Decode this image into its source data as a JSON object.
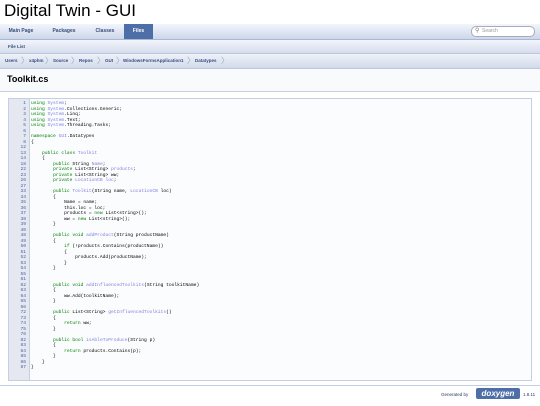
{
  "page": {
    "title": "Digital Twin - GUI"
  },
  "tabs": [
    {
      "label": "Main Page",
      "active": false
    },
    {
      "label": "Packages",
      "active": false
    },
    {
      "label": "Classes",
      "active": false
    },
    {
      "label": "Files",
      "active": true
    }
  ],
  "search": {
    "placeholder": "Search"
  },
  "subnav": {
    "label": "File List"
  },
  "breadcrumbs": [
    "Users",
    "x4phm",
    "Source",
    "Repos",
    "GUI",
    "WindowsFormsApplication1",
    "Datatypes"
  ],
  "file": {
    "title": "Toolkit.cs"
  },
  "code_lines": [
    {
      "n": "1",
      "segs": [
        {
          "t": "using ",
          "c": "kw"
        },
        {
          "t": "System",
          "c": "ty"
        },
        {
          "t": ";"
        }
      ]
    },
    {
      "n": "2",
      "segs": [
        {
          "t": "using ",
          "c": "kw"
        },
        {
          "t": "System",
          "c": "ty"
        },
        {
          "t": ".Collections.Generic;"
        }
      ]
    },
    {
      "n": "3",
      "segs": [
        {
          "t": "using ",
          "c": "kw"
        },
        {
          "t": "System",
          "c": "ty"
        },
        {
          "t": ".Linq;"
        }
      ]
    },
    {
      "n": "4",
      "segs": [
        {
          "t": "using ",
          "c": "kw"
        },
        {
          "t": "System",
          "c": "ty"
        },
        {
          "t": ".Text;"
        }
      ]
    },
    {
      "n": "5",
      "segs": [
        {
          "t": "using ",
          "c": "kw"
        },
        {
          "t": "System",
          "c": "ty"
        },
        {
          "t": ".Threading.Tasks;"
        }
      ]
    },
    {
      "n": "6",
      "segs": []
    },
    {
      "n": "7",
      "segs": [
        {
          "t": "namespace ",
          "c": "kw"
        },
        {
          "t": "GUI",
          "c": "ty"
        },
        {
          "t": ".Datatypes"
        }
      ]
    },
    {
      "n": "8",
      "segs": [
        {
          "t": "{"
        }
      ]
    },
    {
      "n": "12",
      "segs": []
    },
    {
      "n": "13",
      "segs": [
        {
          "t": "    "
        },
        {
          "t": "public class ",
          "c": "kw"
        },
        {
          "t": "Toolkit",
          "c": "ty"
        }
      ]
    },
    {
      "n": "14",
      "segs": [
        {
          "t": "    {"
        }
      ]
    },
    {
      "n": "18",
      "segs": [
        {
          "t": "        "
        },
        {
          "t": "public ",
          "c": "kw"
        },
        {
          "t": "String "
        },
        {
          "t": "Name",
          "c": "ty"
        },
        {
          "t": ";"
        }
      ]
    },
    {
      "n": "22",
      "segs": [
        {
          "t": "        "
        },
        {
          "t": "private ",
          "c": "kw"
        },
        {
          "t": "List<String> "
        },
        {
          "t": "products",
          "c": "ty"
        },
        {
          "t": ";"
        }
      ]
    },
    {
      "n": "23",
      "segs": [
        {
          "t": "        "
        },
        {
          "t": "private ",
          "c": "kw"
        },
        {
          "t": "List<String> ww;"
        }
      ]
    },
    {
      "n": "26",
      "segs": [
        {
          "t": "        "
        },
        {
          "t": "private ",
          "c": "kw"
        },
        {
          "t": "LocationCB loc",
          "c": "ty"
        },
        {
          "t": ";"
        }
      ]
    },
    {
      "n": "27",
      "segs": []
    },
    {
      "n": "33",
      "segs": [
        {
          "t": "        "
        },
        {
          "t": "public ",
          "c": "kw"
        },
        {
          "t": "Toolkit",
          "c": "ty"
        },
        {
          "t": "(String name, "
        },
        {
          "t": "LocationCB",
          "c": "ty"
        },
        {
          "t": " loc)"
        }
      ]
    },
    {
      "n": "34",
      "segs": [
        {
          "t": "        {"
        }
      ]
    },
    {
      "n": "35",
      "segs": [
        {
          "t": "            Name = name;"
        }
      ]
    },
    {
      "n": "36",
      "segs": [
        {
          "t": "            this.loc = loc;"
        }
      ]
    },
    {
      "n": "37",
      "segs": [
        {
          "t": "            products = "
        },
        {
          "t": "new ",
          "c": "kw"
        },
        {
          "t": "List<string>();"
        }
      ]
    },
    {
      "n": "38",
      "segs": [
        {
          "t": "            ww = "
        },
        {
          "t": "new ",
          "c": "kw"
        },
        {
          "t": "List<string>();"
        }
      ]
    },
    {
      "n": "39",
      "segs": [
        {
          "t": "        }"
        }
      ]
    },
    {
      "n": "40",
      "segs": []
    },
    {
      "n": "48",
      "segs": [
        {
          "t": "        "
        },
        {
          "t": "public void ",
          "c": "kw"
        },
        {
          "t": "addProduct",
          "c": "ty"
        },
        {
          "t": "(String productName)"
        }
      ]
    },
    {
      "n": "49",
      "segs": [
        {
          "t": "        {"
        }
      ]
    },
    {
      "n": "50",
      "segs": [
        {
          "t": "            "
        },
        {
          "t": "if ",
          "c": "kw"
        },
        {
          "t": "(!products.Contains(productName))"
        }
      ]
    },
    {
      "n": "51",
      "segs": [
        {
          "t": "            {"
        }
      ]
    },
    {
      "n": "52",
      "segs": [
        {
          "t": "                products.Add(productName);"
        }
      ]
    },
    {
      "n": "53",
      "segs": [
        {
          "t": "            }"
        }
      ]
    },
    {
      "n": "54",
      "segs": [
        {
          "t": "        }"
        }
      ]
    },
    {
      "n": "55",
      "segs": []
    },
    {
      "n": "61",
      "segs": []
    },
    {
      "n": "62",
      "segs": [
        {
          "t": "        "
        },
        {
          "t": "public void ",
          "c": "kw"
        },
        {
          "t": "addInfluencedToolkits",
          "c": "ty"
        },
        {
          "t": "(String toolkitName)"
        }
      ]
    },
    {
      "n": "63",
      "segs": [
        {
          "t": "        {"
        }
      ]
    },
    {
      "n": "64",
      "segs": [
        {
          "t": "            ww.Add(toolkitName);"
        }
      ]
    },
    {
      "n": "65",
      "segs": [
        {
          "t": "        }"
        }
      ]
    },
    {
      "n": "66",
      "segs": []
    },
    {
      "n": "72",
      "segs": [
        {
          "t": "        "
        },
        {
          "t": "public ",
          "c": "kw"
        },
        {
          "t": "List<String> "
        },
        {
          "t": "getInfluencedToolkits",
          "c": "ty"
        },
        {
          "t": "()"
        }
      ]
    },
    {
      "n": "73",
      "segs": [
        {
          "t": "        {"
        }
      ]
    },
    {
      "n": "74",
      "segs": [
        {
          "t": "            "
        },
        {
          "t": "return ",
          "c": "kw"
        },
        {
          "t": "ww;"
        }
      ]
    },
    {
      "n": "75",
      "segs": [
        {
          "t": "        }"
        }
      ]
    },
    {
      "n": "76",
      "segs": []
    },
    {
      "n": "82",
      "segs": [
        {
          "t": "        "
        },
        {
          "t": "public bool ",
          "c": "kw"
        },
        {
          "t": "isAbleToProduce",
          "c": "ty"
        },
        {
          "t": "(String p)"
        }
      ]
    },
    {
      "n": "83",
      "segs": [
        {
          "t": "        {"
        }
      ]
    },
    {
      "n": "84",
      "segs": [
        {
          "t": "            "
        },
        {
          "t": "return ",
          "c": "kw"
        },
        {
          "t": "products.Contains(p);"
        }
      ]
    },
    {
      "n": "85",
      "segs": [
        {
          "t": "        }"
        }
      ]
    },
    {
      "n": "86",
      "segs": [
        {
          "t": "    }"
        }
      ]
    },
    {
      "n": "87",
      "segs": [
        {
          "t": "}"
        }
      ]
    }
  ],
  "footer": {
    "generated_by": "Generated by",
    "logo": "doxygen",
    "version": "1.8.11"
  }
}
